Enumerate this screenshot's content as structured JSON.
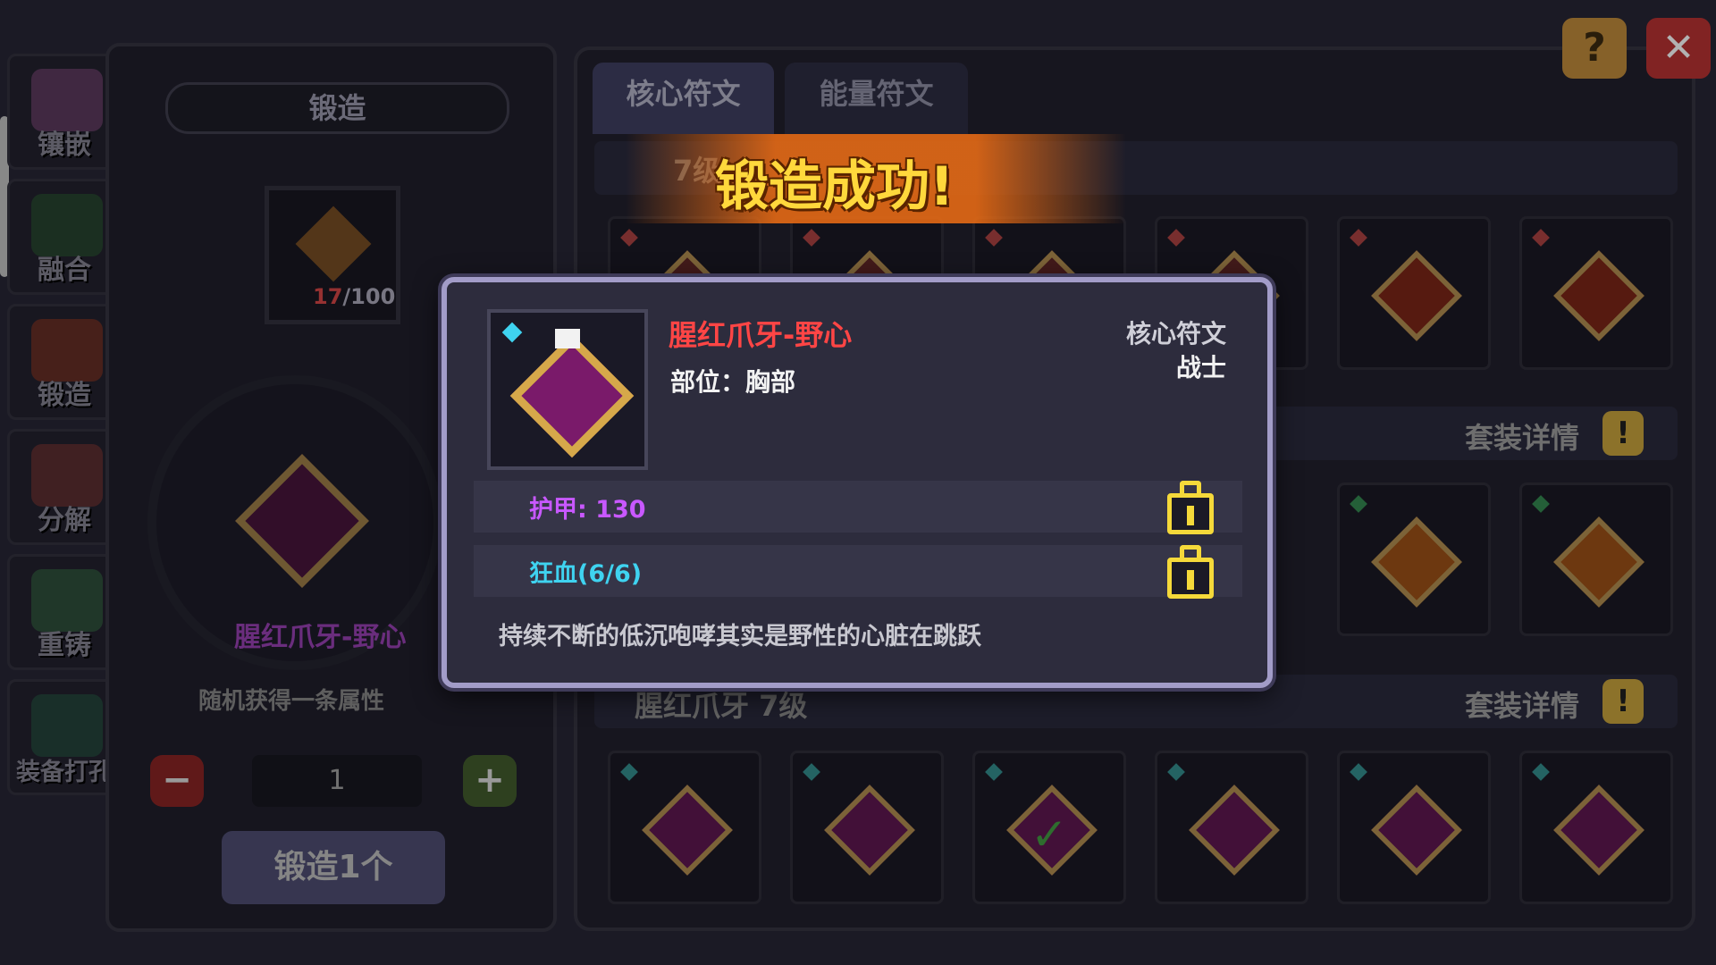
{
  "sidebar": {
    "items": [
      {
        "label": "镶嵌",
        "icon": "inlay-icon"
      },
      {
        "label": "融合",
        "icon": "fusion-icon"
      },
      {
        "label": "锻造",
        "icon": "forge-icon"
      },
      {
        "label": "分解",
        "icon": "decompose-icon"
      },
      {
        "label": "重铸",
        "icon": "recast-icon"
      },
      {
        "label": "装备打孔",
        "icon": "socket-icon"
      }
    ]
  },
  "forge": {
    "title": "锻造",
    "material_current": "17",
    "material_total": "/100",
    "rune_name": "腥红爪牙-野心",
    "random_hint": "随机获得一条属性",
    "quantity": "1",
    "minus": "−",
    "plus": "+",
    "forge_button": "锻造1个"
  },
  "tabs": [
    {
      "label": "核心符文",
      "active": true
    },
    {
      "label": "能量符文",
      "active": false
    }
  ],
  "groups": {
    "level_label": "7级",
    "group2_title": "腥红爪牙 7级",
    "set_detail": "套装详情",
    "excl": "!"
  },
  "top_buttons": {
    "help": "?",
    "close": "✕"
  },
  "banner": {
    "text": "锻造成功!"
  },
  "popup": {
    "name": "腥红爪牙-野心",
    "slot": "部位：胸部",
    "type": "核心符文",
    "class": "战士",
    "stat1": "护甲: 130",
    "stat2": "狂血(6/6)",
    "description": "持续不断的低沉咆哮其实是野性的心脏在跳跃"
  },
  "colors": {
    "rare_red": "#ff4545",
    "armor_purple": "#c858ff",
    "frenzy_cyan": "#3fd3f0",
    "lock_yellow": "#f5d93a",
    "banner_yellow": "#ffd83c"
  }
}
